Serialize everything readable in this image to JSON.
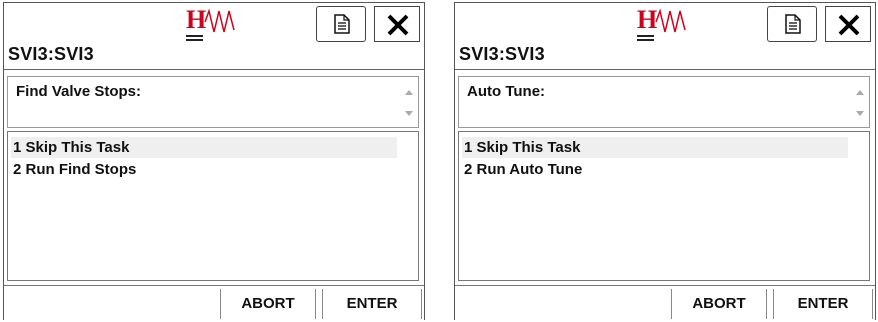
{
  "brand": {
    "logo_letter": "H",
    "accent_color": "#d0021b"
  },
  "screens": [
    {
      "device_title": "SVI3:SVI3",
      "prompt": "Find Valve Stops:",
      "options": [
        "1 Skip This Task",
        "2 Run Find Stops"
      ],
      "selected_index": 0,
      "buttons": {
        "abort": "ABORT",
        "enter": "ENTER"
      },
      "icons": {
        "doc": "document-icon",
        "close": "close-icon"
      }
    },
    {
      "device_title": "SVI3:SVI3",
      "prompt": "Auto Tune:",
      "options": [
        "1 Skip This Task",
        "2 Run Auto Tune"
      ],
      "selected_index": 0,
      "buttons": {
        "abort": "ABORT",
        "enter": "ENTER"
      },
      "icons": {
        "doc": "document-icon",
        "close": "close-icon"
      }
    }
  ]
}
